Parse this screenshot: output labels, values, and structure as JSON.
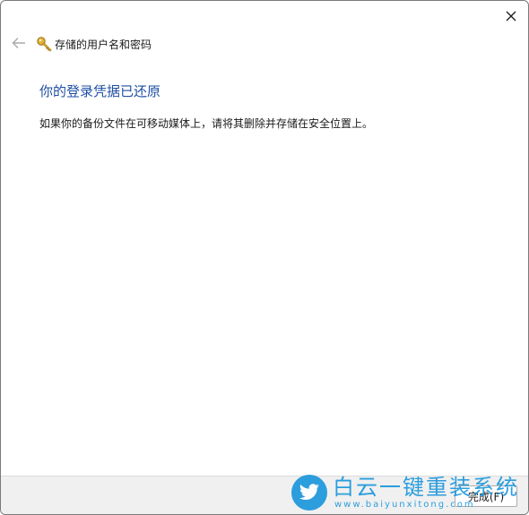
{
  "window": {
    "title": "存储的用户名和密码"
  },
  "content": {
    "heading": "你的登录凭据已还原",
    "message": "如果你的备份文件在可移动媒体上，请将其删除并存储在安全位置上。"
  },
  "footer": {
    "finish_label": "完成(F)"
  },
  "watermark": {
    "title": "白云一键重装系统",
    "url": "www.baiyunxitong.com"
  },
  "icons": {
    "close": "close-icon",
    "back": "back-arrow-icon",
    "key": "key-icon",
    "watermark": "twitter-bird-icon"
  },
  "colors": {
    "heading": "#1e4fa3",
    "watermark": "#1c97dc",
    "footer_bg": "#f0f0f0"
  }
}
